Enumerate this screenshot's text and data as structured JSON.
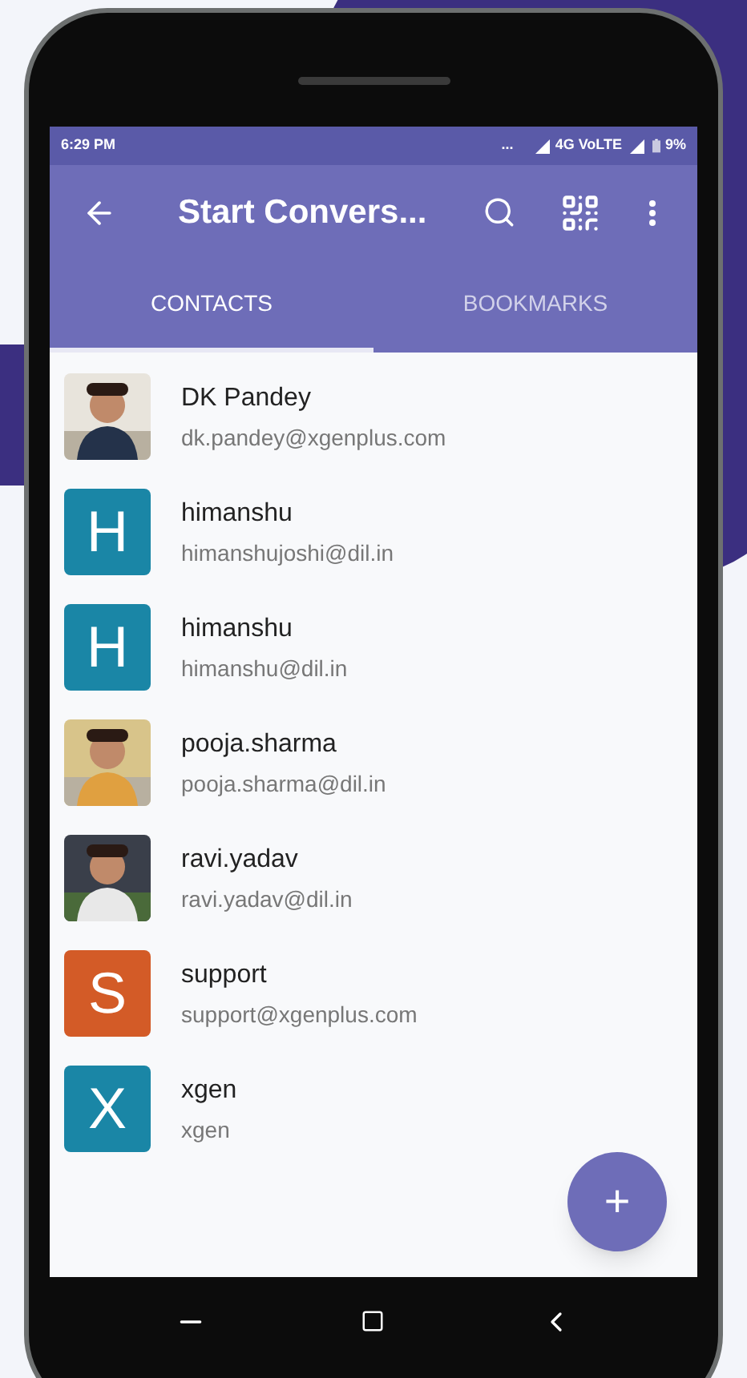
{
  "status_bar": {
    "time": "6:29 PM",
    "dots": "...",
    "network": "4G VoLTE",
    "battery": "9%"
  },
  "toolbar": {
    "title": "Start Convers..."
  },
  "tabs": [
    {
      "label": "CONTACTS",
      "selected": true
    },
    {
      "label": "BOOKMARKS",
      "selected": false
    }
  ],
  "contacts": [
    {
      "name": "DK Pandey",
      "email": "dk.pandey@xgenplus.com"
    },
    {
      "name": "himanshu",
      "email": "himanshujoshi@dil.in",
      "avatar": {
        "kind": "letter",
        "letter": "H",
        "color": "#1a86a6"
      }
    },
    {
      "name": "himanshu",
      "email": "himanshu@dil.in",
      "avatar": {
        "kind": "letter",
        "letter": "H",
        "color": "#1a86a6"
      }
    },
    {
      "name": "pooja.sharma",
      "email": "pooja.sharma@dil.in"
    },
    {
      "name": "ravi.yadav",
      "email": "ravi.yadav@dil.in"
    },
    {
      "name": "support",
      "email": "support@xgenplus.com",
      "avatar": {
        "kind": "letter",
        "letter": "S",
        "color": "#d35b27"
      }
    },
    {
      "name": "xgen",
      "email": "xgen",
      "avatar": {
        "kind": "letter",
        "letter": "X",
        "color": "#1a86a6"
      }
    }
  ],
  "fab": {
    "label": "+"
  }
}
